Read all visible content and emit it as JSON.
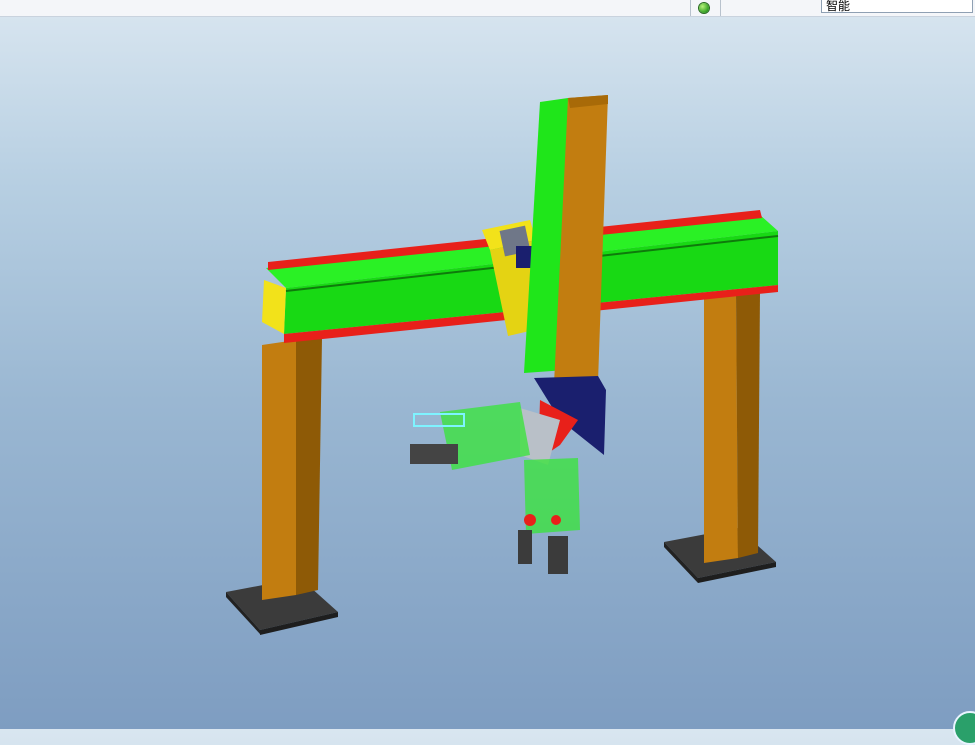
{
  "topbar": {
    "status_icon": "green-light-icon",
    "filter_value": "智能"
  },
  "viewport": {
    "model_parts": [
      "left-support-column",
      "right-support-column",
      "left-base-plate",
      "right-base-plate",
      "horizontal-beam",
      "vertical-arm",
      "carriage",
      "wrist-joint",
      "gripper-left",
      "gripper-bottom"
    ]
  },
  "colors": {
    "beam_green": "#1fe61a",
    "column_brown": "#b5730b",
    "rail_red": "#e8201a",
    "carriage_yellow": "#f2e21a",
    "joint_navy": "#1a1f6e",
    "base_dark": "#3a3a3a"
  }
}
